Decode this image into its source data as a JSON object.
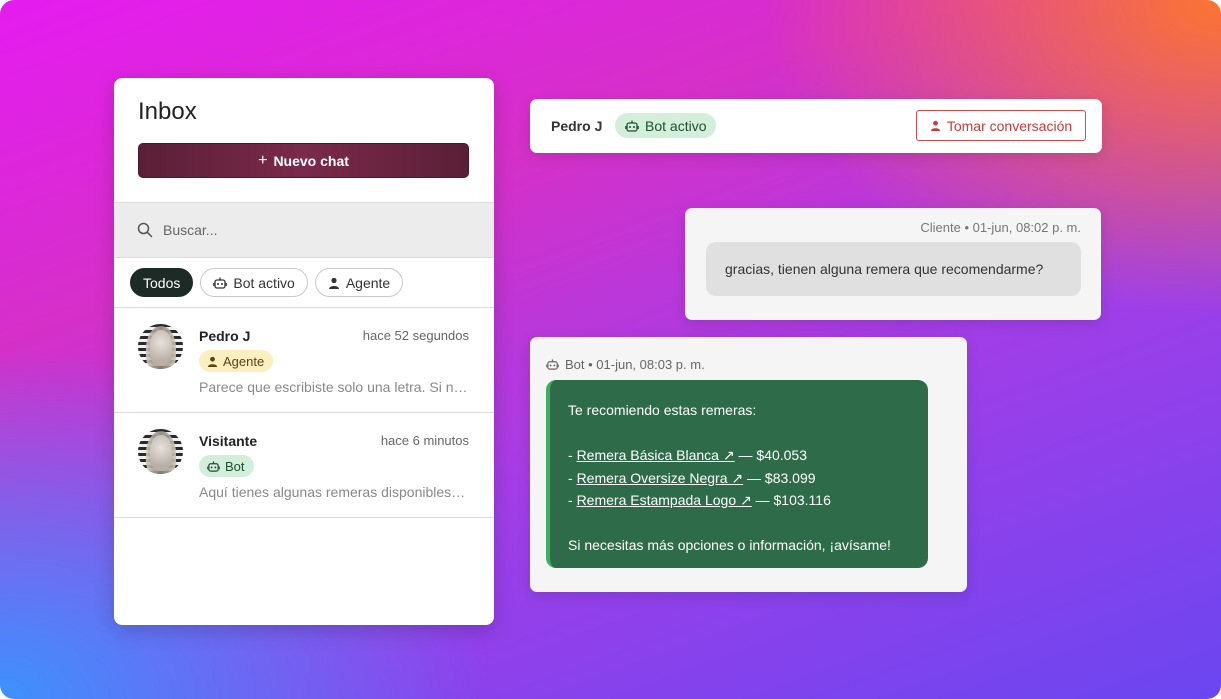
{
  "colors": {
    "primary_button": "#6b2540",
    "bot_bubble": "#2e6b48",
    "bot_accent": "#3fae63",
    "agent_badge_bg": "#fbeec0",
    "bot_badge_bg": "#d3eedb",
    "danger": "#c93a3a"
  },
  "inbox": {
    "title": "Inbox",
    "new_chat_label": "Nuevo chat",
    "new_chat_icon": "plus-icon",
    "search": {
      "placeholder": "Buscar...",
      "icon": "search-icon"
    },
    "filters": [
      {
        "label": "Todos",
        "active": true
      },
      {
        "label": "Bot activo",
        "icon": "robot-icon",
        "active": false
      },
      {
        "label": "Agente",
        "icon": "user-icon",
        "active": false
      }
    ],
    "conversations": [
      {
        "name": "Pedro J",
        "time": "hace 52 segundos",
        "badge": "Agente",
        "badge_icon": "user-icon",
        "preview": "Parece que escribiste solo una letra. Si necesitas ayuda, cuéntame."
      },
      {
        "name": "Visitante",
        "time": "hace 6 minutos",
        "badge": "Bot",
        "badge_icon": "robot-icon",
        "preview": "Aquí tienes algunas remeras disponibles en nuestra tienda."
      }
    ]
  },
  "chat": {
    "header": {
      "name": "Pedro J",
      "status": "Bot activo",
      "status_icon": "robot-icon",
      "take_label": "Tomar conversación",
      "take_icon": "user-icon"
    },
    "messages": [
      {
        "meta": "Cliente • 01-jun, 08:02 p. m.",
        "text": "gracias, tienen alguna remera que recomendarme?"
      },
      {
        "meta": "Bot • 01-jun, 08:03 p. m.",
        "meta_icon": "robot-icon",
        "intro": "Te recomiendo estas remeras:",
        "items": [
          {
            "prefix": "- ",
            "link": "Remera Básica Blanca ↗",
            "price": " — $40.053"
          },
          {
            "prefix": "- ",
            "link": "Remera Oversize Negra ↗",
            "price": " — $83.099"
          },
          {
            "prefix": "- ",
            "link": "Remera Estampada Logo ↗",
            "price": " — $103.116"
          }
        ],
        "outro": "Si necesitas más opciones o información, ¡avísame!"
      }
    ]
  }
}
